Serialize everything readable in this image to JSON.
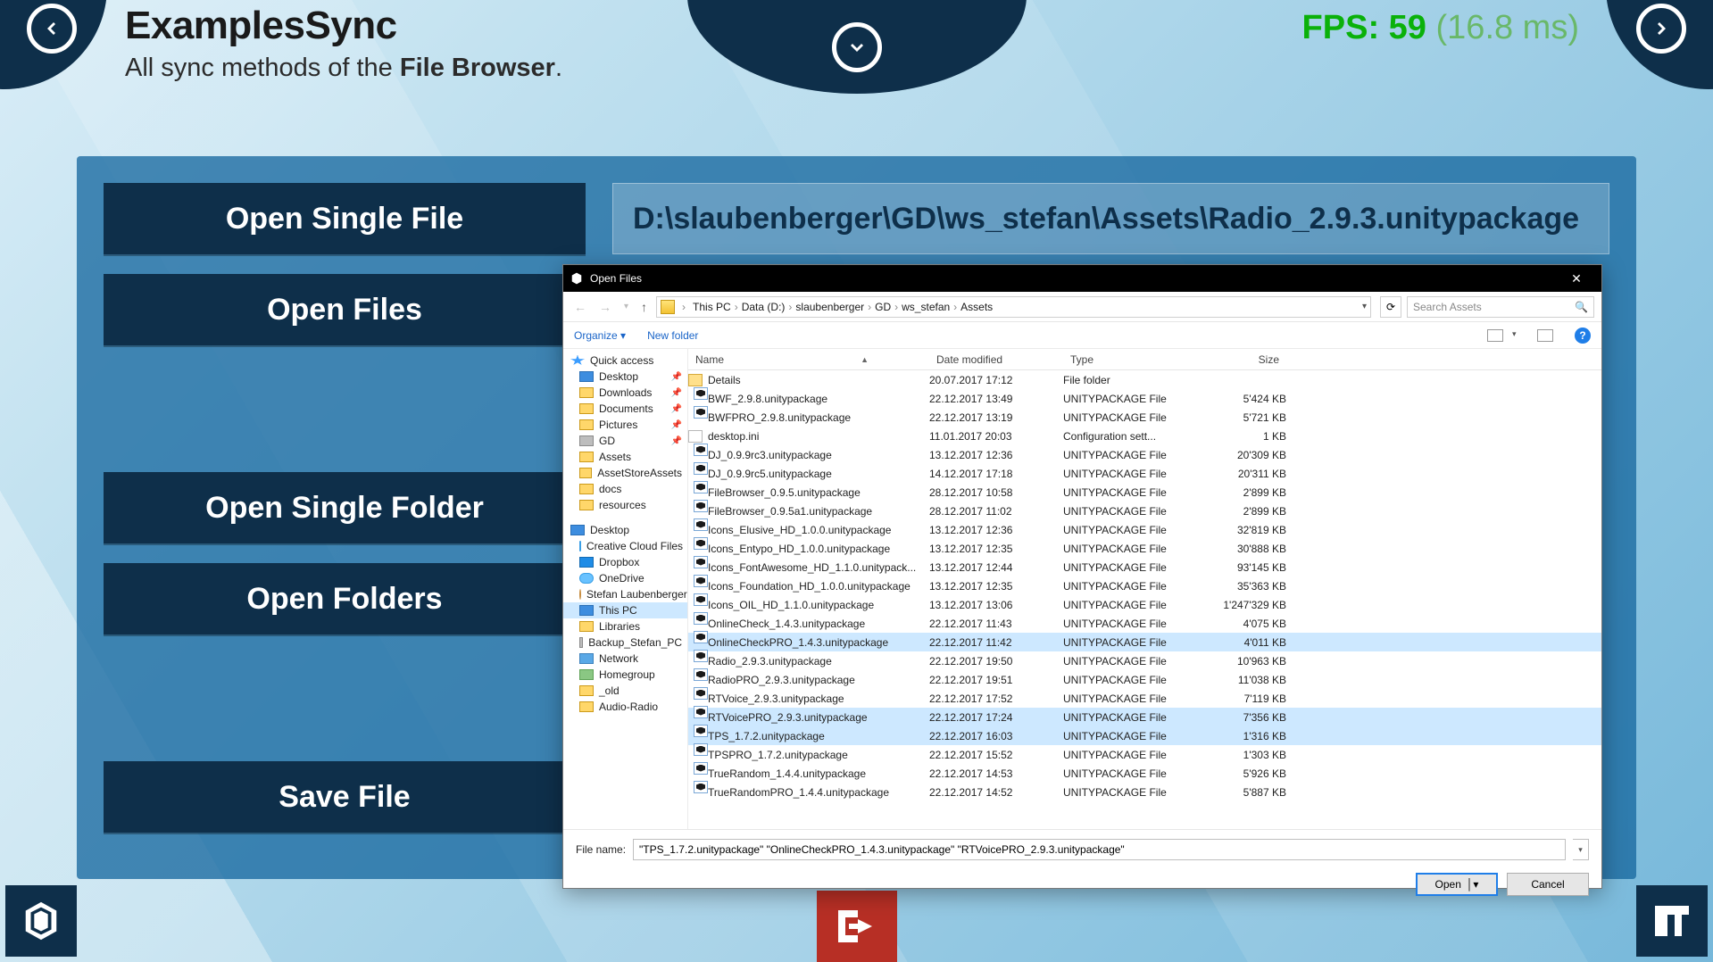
{
  "header": {
    "title": "ExamplesSync",
    "subtitle_pre": "All sync methods of the ",
    "subtitle_bold": "File Browser",
    "subtitle_post": "."
  },
  "fps": {
    "label": "FPS:",
    "value": "59",
    "ms": "(16.8 ms)"
  },
  "buttons": {
    "open_single_file": "Open Single File",
    "open_files": "Open Files",
    "open_single_folder": "Open Single Folder",
    "open_folders": "Open Folders",
    "save_file": "Save File"
  },
  "path_display": "D:\\slaubenberger\\GD\\ws_stefan\\Assets\\Radio_2.9.3.unitypackage",
  "dialog": {
    "title": "Open Files",
    "crumbs": [
      "This PC",
      "Data (D:)",
      "slaubenberger",
      "GD",
      "ws_stefan",
      "Assets"
    ],
    "search_placeholder": "Search Assets",
    "toolbar": {
      "organize": "Organize",
      "new_folder": "New folder"
    },
    "nav": {
      "quick_access": "Quick access",
      "items1": [
        "Desktop",
        "Downloads",
        "Documents",
        "Pictures",
        "GD",
        "Assets",
        "AssetStoreAssets",
        "docs",
        "resources"
      ],
      "desktop_head": "Desktop",
      "items2": [
        "Creative Cloud Files",
        "Dropbox",
        "OneDrive",
        "Stefan Laubenberger",
        "This PC",
        "Libraries",
        "Backup_Stefan_PC",
        "Network",
        "Homegroup",
        "_old",
        "Audio-Radio"
      ]
    },
    "columns": {
      "name": "Name",
      "date": "Date modified",
      "type": "Type",
      "size": "Size"
    },
    "rows": [
      {
        "n": "Details",
        "d": "20.07.2017 17:12",
        "t": "File folder",
        "s": "",
        "ico": "folder",
        "sel": false
      },
      {
        "n": "BWF_2.9.8.unitypackage",
        "d": "22.12.2017 13:49",
        "t": "UNITYPACKAGE File",
        "s": "5'424 KB",
        "ico": "unity",
        "sel": false
      },
      {
        "n": "BWFPRO_2.9.8.unitypackage",
        "d": "22.12.2017 13:19",
        "t": "UNITYPACKAGE File",
        "s": "5'721 KB",
        "ico": "unity",
        "sel": false
      },
      {
        "n": "desktop.ini",
        "d": "11.01.2017 20:03",
        "t": "Configuration sett...",
        "s": "1 KB",
        "ico": "ini",
        "sel": false
      },
      {
        "n": "DJ_0.9.9rc3.unitypackage",
        "d": "13.12.2017 12:36",
        "t": "UNITYPACKAGE File",
        "s": "20'309 KB",
        "ico": "unity",
        "sel": false
      },
      {
        "n": "DJ_0.9.9rc5.unitypackage",
        "d": "14.12.2017 17:18",
        "t": "UNITYPACKAGE File",
        "s": "20'311 KB",
        "ico": "unity",
        "sel": false
      },
      {
        "n": "FileBrowser_0.9.5.unitypackage",
        "d": "28.12.2017 10:58",
        "t": "UNITYPACKAGE File",
        "s": "2'899 KB",
        "ico": "unity",
        "sel": false
      },
      {
        "n": "FileBrowser_0.9.5a1.unitypackage",
        "d": "28.12.2017 11:02",
        "t": "UNITYPACKAGE File",
        "s": "2'899 KB",
        "ico": "unity",
        "sel": false
      },
      {
        "n": "Icons_Elusive_HD_1.0.0.unitypackage",
        "d": "13.12.2017 12:36",
        "t": "UNITYPACKAGE File",
        "s": "32'819 KB",
        "ico": "unity",
        "sel": false
      },
      {
        "n": "Icons_Entypo_HD_1.0.0.unitypackage",
        "d": "13.12.2017 12:35",
        "t": "UNITYPACKAGE File",
        "s": "30'888 KB",
        "ico": "unity",
        "sel": false
      },
      {
        "n": "Icons_FontAwesome_HD_1.1.0.unitypack...",
        "d": "13.12.2017 12:44",
        "t": "UNITYPACKAGE File",
        "s": "93'145 KB",
        "ico": "unity",
        "sel": false
      },
      {
        "n": "Icons_Foundation_HD_1.0.0.unitypackage",
        "d": "13.12.2017 12:35",
        "t": "UNITYPACKAGE File",
        "s": "35'363 KB",
        "ico": "unity",
        "sel": false
      },
      {
        "n": "Icons_OIL_HD_1.1.0.unitypackage",
        "d": "13.12.2017 13:06",
        "t": "UNITYPACKAGE File",
        "s": "1'247'329 KB",
        "ico": "unity",
        "sel": false
      },
      {
        "n": "OnlineCheck_1.4.3.unitypackage",
        "d": "22.12.2017 11:43",
        "t": "UNITYPACKAGE File",
        "s": "4'075 KB",
        "ico": "unity",
        "sel": false
      },
      {
        "n": "OnlineCheckPRO_1.4.3.unitypackage",
        "d": "22.12.2017 11:42",
        "t": "UNITYPACKAGE File",
        "s": "4'011 KB",
        "ico": "unity",
        "sel": true
      },
      {
        "n": "Radio_2.9.3.unitypackage",
        "d": "22.12.2017 19:50",
        "t": "UNITYPACKAGE File",
        "s": "10'963 KB",
        "ico": "unity",
        "sel": false
      },
      {
        "n": "RadioPRO_2.9.3.unitypackage",
        "d": "22.12.2017 19:51",
        "t": "UNITYPACKAGE File",
        "s": "11'038 KB",
        "ico": "unity",
        "sel": false
      },
      {
        "n": "RTVoice_2.9.3.unitypackage",
        "d": "22.12.2017 17:52",
        "t": "UNITYPACKAGE File",
        "s": "7'119 KB",
        "ico": "unity",
        "sel": false
      },
      {
        "n": "RTVoicePRO_2.9.3.unitypackage",
        "d": "22.12.2017 17:24",
        "t": "UNITYPACKAGE File",
        "s": "7'356 KB",
        "ico": "unity",
        "sel": true
      },
      {
        "n": "TPS_1.7.2.unitypackage",
        "d": "22.12.2017 16:03",
        "t": "UNITYPACKAGE File",
        "s": "1'316 KB",
        "ico": "unity",
        "sel": true
      },
      {
        "n": "TPSPRO_1.7.2.unitypackage",
        "d": "22.12.2017 15:52",
        "t": "UNITYPACKAGE File",
        "s": "1'303 KB",
        "ico": "unity",
        "sel": false
      },
      {
        "n": "TrueRandom_1.4.4.unitypackage",
        "d": "22.12.2017 14:53",
        "t": "UNITYPACKAGE File",
        "s": "5'926 KB",
        "ico": "unity",
        "sel": false
      },
      {
        "n": "TrueRandomPRO_1.4.4.unitypackage",
        "d": "22.12.2017 14:52",
        "t": "UNITYPACKAGE File",
        "s": "5'887 KB",
        "ico": "unity",
        "sel": false
      }
    ],
    "filename_label": "File name:",
    "filename_value": "\"TPS_1.7.2.unitypackage\" \"OnlineCheckPRO_1.4.3.unitypackage\" \"RTVoicePRO_2.9.3.unitypackage\"",
    "open_btn": "Open",
    "cancel_btn": "Cancel"
  }
}
